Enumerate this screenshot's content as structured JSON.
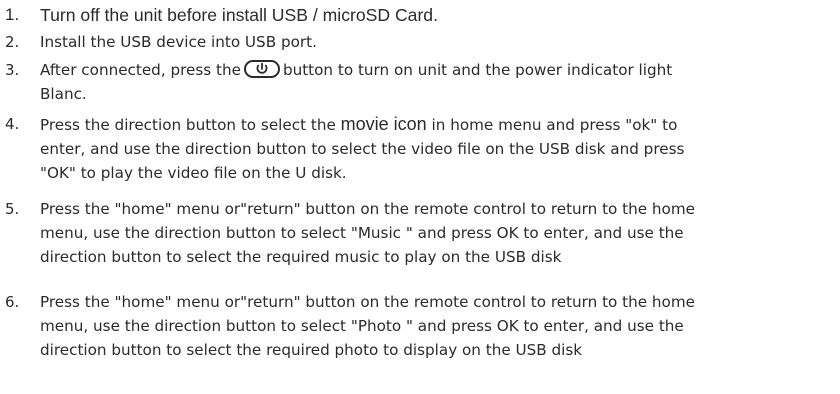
{
  "steps": [
    {
      "number": "1.",
      "text": "Turn off the unit before install USB / microSD Card."
    },
    {
      "number": "2.",
      "text": "Install the USB device into USB port."
    },
    {
      "number": "3.",
      "text_before_icon": "After connected, press the",
      "icon": "power-icon",
      "text_after_icon": "button to turn on unit and the power indicator light",
      "line2": "Blanc."
    },
    {
      "number": "4.",
      "line1_a": "Press the direction button to select the",
      "line1_emph": "movie icon",
      "line1_b": "in home menu and press \"ok\" to",
      "line2": "enter, and use the direction button to select the video file on the USB disk and press",
      "line3": "\"OK\" to play the video file on the U disk."
    },
    {
      "number": "5.",
      "line1": "Press the \"home\" menu or\"return\" button on the remote control to return to the home",
      "line2": "menu, use the direction button to select \"Music \" and press OK to enter, and use the",
      "line3": "direction button to select the required music to play on the USB disk"
    },
    {
      "number": "6.",
      "line1": "Press the \"home\" menu or\"return\" button on the remote control to return to the home",
      "line2": "menu, use the direction button to select \"Photo \" and press OK to enter, and use the",
      "line3": "direction button to select the required photo to display on the USB disk"
    }
  ]
}
